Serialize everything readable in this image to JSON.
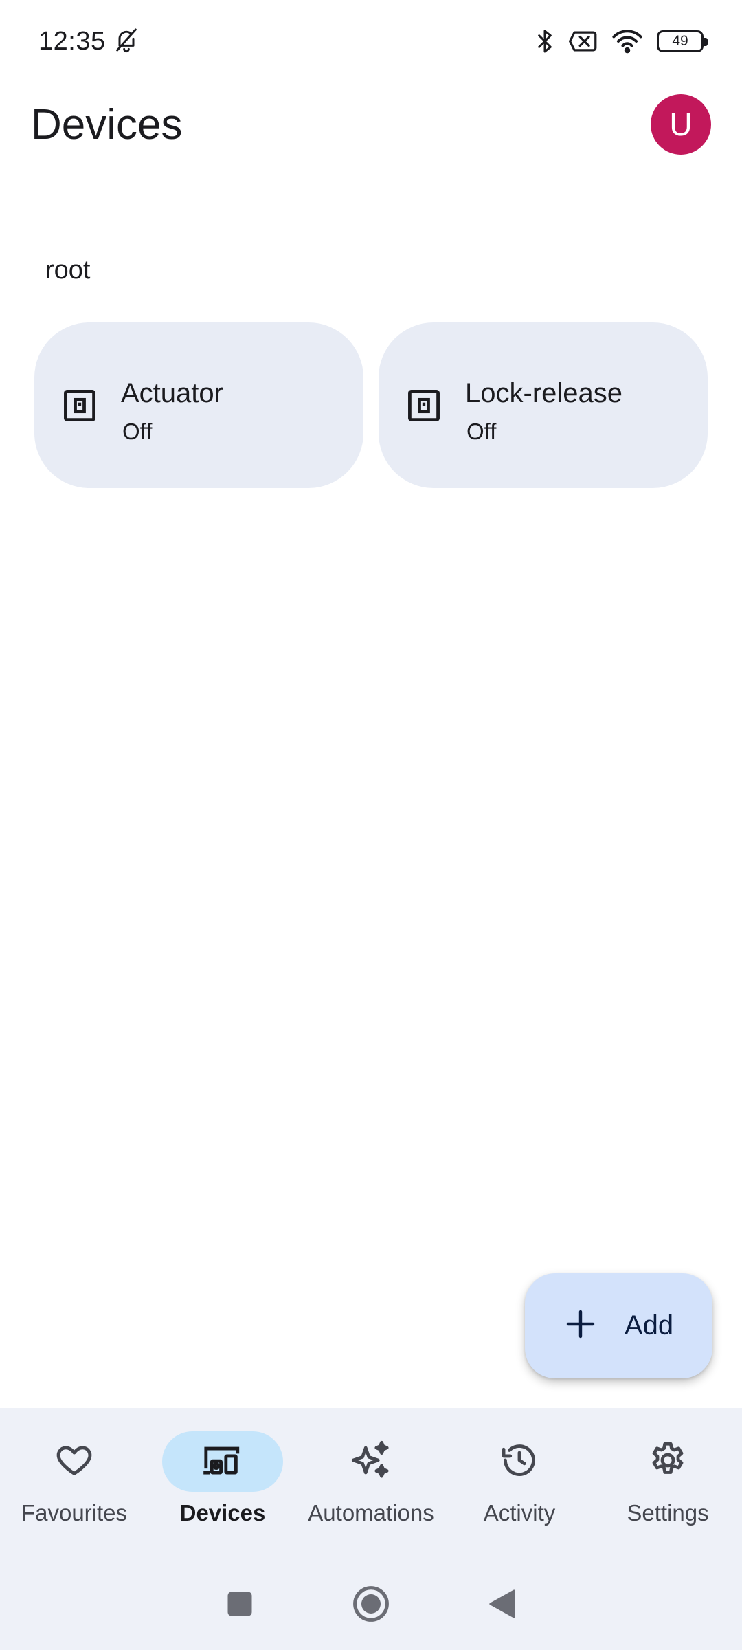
{
  "status_bar": {
    "time": "12:35",
    "battery": "49",
    "icons": [
      "bell-off-icon",
      "bluetooth-icon",
      "no-sim-icon",
      "wifi-icon",
      "battery-icon"
    ]
  },
  "app_bar": {
    "title": "Devices",
    "avatar_initial": "U"
  },
  "section": {
    "label": "root",
    "devices": [
      {
        "name": "Actuator",
        "state": "Off",
        "icon": "device-square-icon"
      },
      {
        "name": "Lock-release",
        "state": "Off",
        "icon": "device-square-icon"
      }
    ]
  },
  "fab": {
    "label": "Add",
    "icon": "plus-icon"
  },
  "bottom_nav": {
    "items": [
      {
        "label": "Favourites",
        "icon": "heart-icon",
        "active": false
      },
      {
        "label": "Devices",
        "icon": "devices-icon",
        "active": true
      },
      {
        "label": "Automations",
        "icon": "sparkle-icon",
        "active": false
      },
      {
        "label": "Activity",
        "icon": "history-icon",
        "active": false
      },
      {
        "label": "Settings",
        "icon": "gear-icon",
        "active": false
      }
    ]
  },
  "system_nav": {
    "buttons": [
      "recents-button",
      "home-button",
      "back-button"
    ]
  },
  "colors": {
    "avatar": "#c2185b",
    "card": "#e8ecf5",
    "fab": "#d3e2fb",
    "nav_background": "#eef1f8",
    "nav_active_pill": "#c5e5fb"
  }
}
